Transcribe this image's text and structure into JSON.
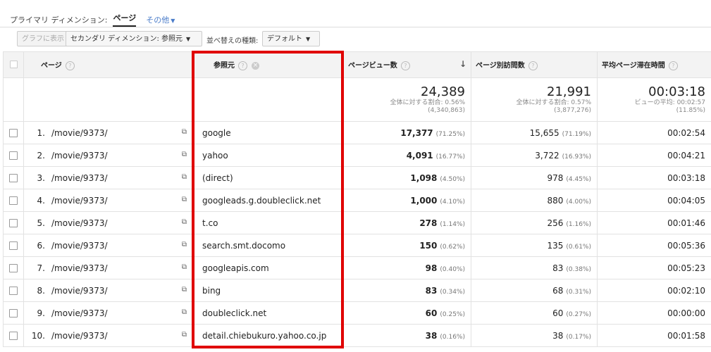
{
  "primary_dimension": {
    "label": "プライマリ ディメンション:",
    "current": "ページ",
    "other": "その他"
  },
  "toolbar": {
    "graph_button": "グラフに表示",
    "secondary_dimension": "セカンダリ ディメンション: 参照元",
    "sort_label": "並べ替えの種類:",
    "sort_value": "デフォルト"
  },
  "columns": {
    "page": "ページ",
    "source": "参照元",
    "pageviews": "ページビュー数",
    "unique_pageviews": "ページ別訪問数",
    "avg_time": "平均ページ滞在時間"
  },
  "totals": {
    "pageviews": {
      "value": "24,389",
      "sub1": "全体に対する割合: 0.56%",
      "sub2": "(4,340,863)"
    },
    "unique_pageviews": {
      "value": "21,991",
      "sub1": "全体に対する割合: 0.57%",
      "sub2": "(3,877,276)"
    },
    "avg_time": {
      "value": "00:03:18",
      "sub1": "ビューの平均: 00:02:57",
      "sub2": "(11.85%)"
    }
  },
  "rows": [
    {
      "rank": "1.",
      "page": "/movie/9373/",
      "source": "google",
      "pv": "17,377",
      "pv_pct": "(71.25%)",
      "upv": "15,655",
      "upv_pct": "(71.19%)",
      "time": "00:02:54"
    },
    {
      "rank": "2.",
      "page": "/movie/9373/",
      "source": "yahoo",
      "pv": "4,091",
      "pv_pct": "(16.77%)",
      "upv": "3,722",
      "upv_pct": "(16.93%)",
      "time": "00:04:21"
    },
    {
      "rank": "3.",
      "page": "/movie/9373/",
      "source": "(direct)",
      "pv": "1,098",
      "pv_pct": "(4.50%)",
      "upv": "978",
      "upv_pct": "(4.45%)",
      "time": "00:03:18"
    },
    {
      "rank": "4.",
      "page": "/movie/9373/",
      "source": "googleads.g.doubleclick.net",
      "pv": "1,000",
      "pv_pct": "(4.10%)",
      "upv": "880",
      "upv_pct": "(4.00%)",
      "time": "00:04:05"
    },
    {
      "rank": "5.",
      "page": "/movie/9373/",
      "source": "t.co",
      "pv": "278",
      "pv_pct": "(1.14%)",
      "upv": "256",
      "upv_pct": "(1.16%)",
      "time": "00:01:46"
    },
    {
      "rank": "6.",
      "page": "/movie/9373/",
      "source": "search.smt.docomo",
      "pv": "150",
      "pv_pct": "(0.62%)",
      "upv": "135",
      "upv_pct": "(0.61%)",
      "time": "00:05:36"
    },
    {
      "rank": "7.",
      "page": "/movie/9373/",
      "source": "googleapis.com",
      "pv": "98",
      "pv_pct": "(0.40%)",
      "upv": "83",
      "upv_pct": "(0.38%)",
      "time": "00:05:23"
    },
    {
      "rank": "8.",
      "page": "/movie/9373/",
      "source": "bing",
      "pv": "83",
      "pv_pct": "(0.34%)",
      "upv": "68",
      "upv_pct": "(0.31%)",
      "time": "00:02:10"
    },
    {
      "rank": "9.",
      "page": "/movie/9373/",
      "source": "doubleclick.net",
      "pv": "60",
      "pv_pct": "(0.25%)",
      "upv": "60",
      "upv_pct": "(0.27%)",
      "time": "00:00:00"
    },
    {
      "rank": "10.",
      "page": "/movie/9373/",
      "source": "detail.chiebukuro.yahoo.co.jp",
      "pv": "38",
      "pv_pct": "(0.16%)",
      "upv": "38",
      "upv_pct": "(0.17%)",
      "time": "00:01:58"
    }
  ],
  "colors": {
    "highlight": "#e00000",
    "link": "#4a7cc9",
    "header_bg": "#f3f3f3"
  }
}
